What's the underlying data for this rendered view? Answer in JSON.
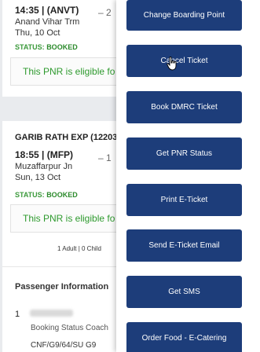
{
  "cards": [
    {
      "time": "14:35 | (ANVT)",
      "station": "Anand Vihar Trm",
      "date": "Thu, 10 Oct",
      "status_label": "STATUS:",
      "status_value": "BOOKED",
      "eligible_text": "This PNR is eligible fo",
      "dash": "– 2"
    },
    {
      "train": "GARIB RATH EXP (12203)",
      "time": "18:55 | (MFP)",
      "station": "Muzaffarpur Jn",
      "date": "Sun, 13 Oct",
      "status_label": "STATUS:",
      "status_value": "BOOKED",
      "eligible_text": "This PNR is eligible fo",
      "dash": "– 1",
      "passenger_count": "1 Adult | 0 Child",
      "passenger_section_title": "Passenger Information",
      "passenger_number": "1",
      "booking_status_label": "Booking Status  Coach",
      "booking_status_value": "CNF/G9/64/SU G9"
    }
  ],
  "menu": {
    "items": [
      "Change Boarding Point",
      "Cancel Ticket",
      "Book DMRC Ticket",
      "Get PNR Status",
      "Print E-Ticket",
      "Send E-Ticket Email",
      "Get SMS",
      "Order Food - E-Catering"
    ]
  },
  "colors": {
    "menu_button": "#1d3d7a",
    "status_green": "#2b8a2b",
    "background": "#e9ebee"
  }
}
